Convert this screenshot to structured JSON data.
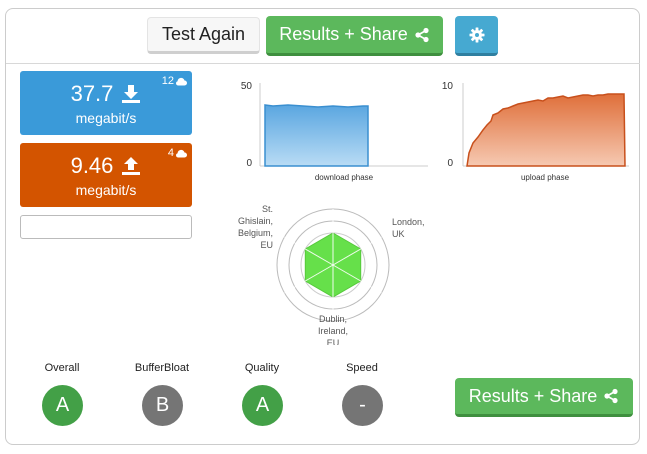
{
  "header": {
    "test_again_label": "Test Again",
    "results_share_label": "Results + Share",
    "settings_icon": "gear-icon"
  },
  "download": {
    "value": "37.7",
    "unit": "megabit/s",
    "connections": "12",
    "color": "#3a9ad9"
  },
  "upload": {
    "value": "9.46",
    "unit": "megabit/s",
    "connections": "4",
    "color": "#d35400"
  },
  "download_chart": {
    "y_max_label": "50",
    "y_min_label": "0",
    "caption": "download phase"
  },
  "upload_chart": {
    "y_max_label": "10",
    "y_min_label": "0",
    "caption": "upload phase"
  },
  "radar": {
    "labels": {
      "left": [
        "St.",
        "Ghislain,",
        "Belgium,",
        "EU"
      ],
      "right": [
        "London,",
        "UK"
      ],
      "bottom": [
        "Dublin,",
        "Ireland,",
        "EU"
      ]
    }
  },
  "grades": [
    {
      "label": "Overall",
      "grade": "A",
      "color": "#43a047"
    },
    {
      "label": "BufferBloat",
      "grade": "B",
      "color": "#757575"
    },
    {
      "label": "Quality",
      "grade": "A",
      "color": "#43a047"
    },
    {
      "label": "Speed",
      "grade": "-",
      "color": "#757575"
    }
  ],
  "footer": {
    "results_share_label": "Results + Share"
  }
}
